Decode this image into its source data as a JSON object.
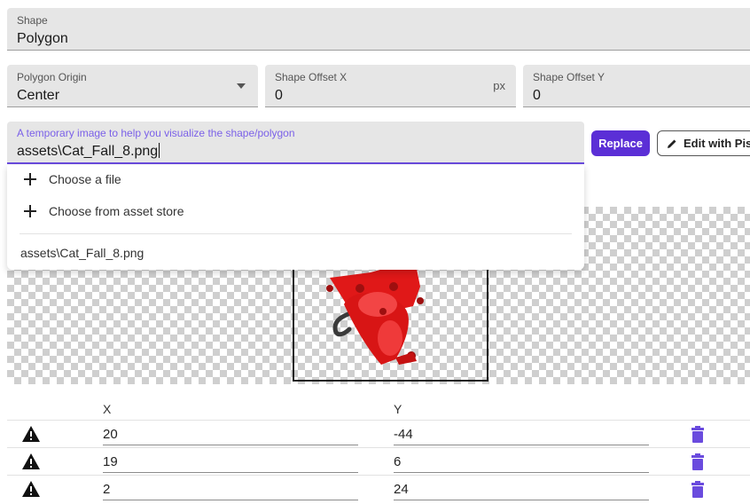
{
  "shape": {
    "label": "Shape",
    "value": "Polygon"
  },
  "polygon_origin": {
    "label": "Polygon Origin",
    "value": "Center"
  },
  "offset_x": {
    "label": "Shape Offset X",
    "value": "0",
    "unit": "px"
  },
  "offset_y": {
    "label": "Shape Offset Y",
    "value": "0"
  },
  "image_field": {
    "label": "A temporary image to help you visualize the shape/polygon",
    "value": "assets\\Cat_Fall_8.png"
  },
  "buttons": {
    "replace": "Replace",
    "edit": "Edit with Pisk"
  },
  "dropdown": {
    "choose_file": "Choose a file",
    "choose_asset_store": "Choose from asset store",
    "recent": "assets\\Cat_Fall_8.png"
  },
  "table": {
    "headers": {
      "x": "X",
      "y": "Y"
    },
    "rows": [
      {
        "x": "20",
        "y": "-44"
      },
      {
        "x": "19",
        "y": "6"
      },
      {
        "x": "2",
        "y": "24"
      }
    ]
  },
  "colors": {
    "accent": "#5b2fd6",
    "delete_icon": "#6a4bde",
    "focused_label": "#7b61e8"
  },
  "icons": {
    "origin_dropdown": "caret-down-icon",
    "add": "plus-icon",
    "edit": "pencil-icon",
    "warning": "warning-icon",
    "delete": "trash-icon"
  }
}
